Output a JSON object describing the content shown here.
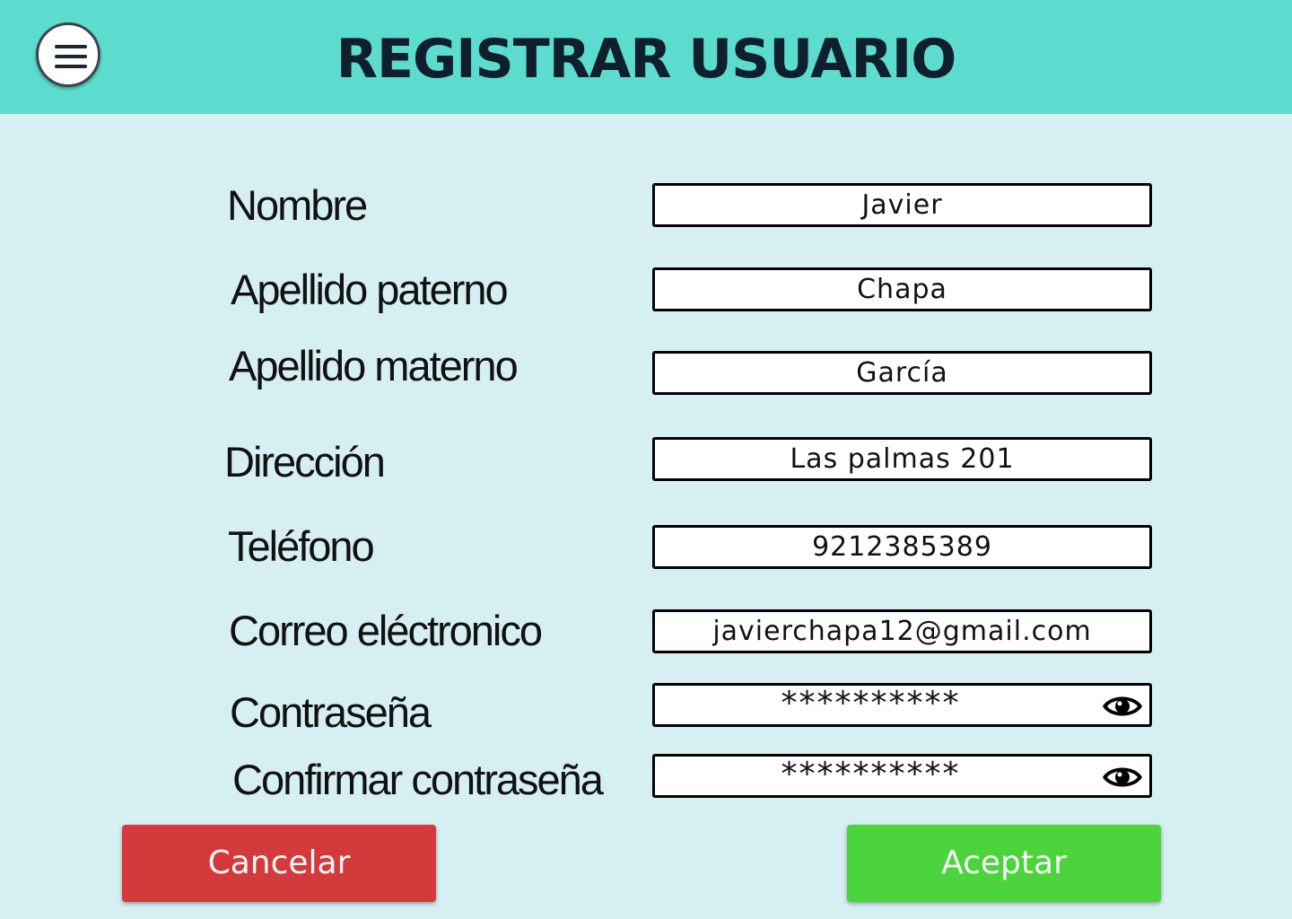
{
  "header": {
    "title": "REGISTRAR USUARIO",
    "menu_icon": "hamburger-menu-icon",
    "background_color": "#5cdbcf"
  },
  "form": {
    "fields": [
      {
        "label": "Nombre",
        "value": "Javier"
      },
      {
        "label": "Apellido paterno",
        "value": "Chapa"
      },
      {
        "label": "Apellido materno",
        "value": "García"
      },
      {
        "label": "Dirección",
        "value": "Las palmas 201"
      },
      {
        "label": "Teléfono",
        "value": "9212385389"
      },
      {
        "label": "Correo eléctronico",
        "value": "javierchapa12@gmail.com"
      },
      {
        "label": "Contraseña",
        "value": "**********",
        "icon": "eye-icon"
      },
      {
        "label": "Confirmar contraseña",
        "value": "**********",
        "icon": "eye-icon"
      }
    ]
  },
  "actions": {
    "cancel_label": "Cancelar",
    "accept_label": "Aceptar",
    "cancel_color": "#d43a3c",
    "accept_color": "#4cd43c"
  }
}
